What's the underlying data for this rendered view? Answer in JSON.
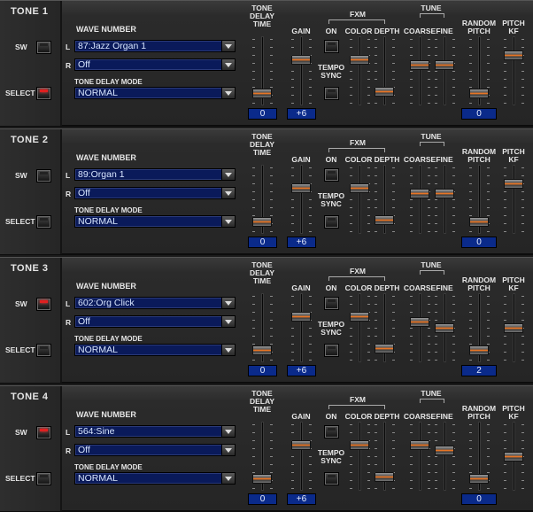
{
  "labels": {
    "sw": "SW",
    "select": "SELECT",
    "wave_number": "WAVE NUMBER",
    "l": "L",
    "r": "R",
    "tone_delay_mode": "TONE DELAY MODE",
    "tone_delay_time": "TONE\nDELAY\nTIME",
    "gain": "GAIN",
    "fxm": "FXM",
    "on": "ON",
    "color": "COLOR",
    "depth": "DEPTH",
    "tempo_sync": "TEMPO\nSYNC",
    "tune": "TUNE",
    "coarse": "COARSE",
    "fine": "FINE",
    "random_pitch": "RANDOM\nPITCH",
    "pitch_kf": "PITCH\nKF"
  },
  "colors": {
    "field_bg": "#0a1a5a",
    "value_box": "#0a2a8a",
    "led_on": "#e02020",
    "knob_accent": "#f08030"
  },
  "tones": [
    {
      "title": "TONE 1",
      "sw_on": false,
      "select_on": true,
      "wave_l": "87:Jazz Organ 1",
      "wave_r": "Off",
      "delay_mode": "NORMAL",
      "delay_time": "0",
      "gain": "+6",
      "random_pitch": "0",
      "fxm_on": false,
      "tempo_sync": false,
      "levels": {
        "delay": 0.12,
        "gain": 0.7,
        "color": 0.7,
        "depth": 0.15,
        "coarse": 0.6,
        "fine": 0.6,
        "random": 0.12,
        "kf": 0.78
      }
    },
    {
      "title": "TONE 2",
      "sw_on": false,
      "select_on": false,
      "wave_l": "89:Organ 1",
      "wave_r": "Off",
      "delay_mode": "NORMAL",
      "delay_time": "0",
      "gain": "+6",
      "random_pitch": "0",
      "fxm_on": false,
      "tempo_sync": false,
      "levels": {
        "delay": 0.12,
        "gain": 0.7,
        "color": 0.7,
        "depth": 0.15,
        "coarse": 0.6,
        "fine": 0.6,
        "random": 0.12,
        "kf": 0.78
      }
    },
    {
      "title": "TONE 3",
      "sw_on": true,
      "select_on": false,
      "wave_l": "602:Org Click",
      "wave_r": "Off",
      "delay_mode": "NORMAL",
      "delay_time": "0",
      "gain": "+6",
      "random_pitch": "2",
      "fxm_on": false,
      "tempo_sync": false,
      "levels": {
        "delay": 0.12,
        "gain": 0.7,
        "color": 0.7,
        "depth": 0.15,
        "coarse": 0.6,
        "fine": 0.5,
        "random": 0.12,
        "kf": 0.5
      }
    },
    {
      "title": "TONE 4",
      "sw_on": true,
      "select_on": false,
      "wave_l": "564:Sine",
      "wave_r": "Off",
      "delay_mode": "NORMAL",
      "delay_time": "0",
      "gain": "+6",
      "random_pitch": "0",
      "fxm_on": false,
      "tempo_sync": false,
      "levels": {
        "delay": 0.12,
        "gain": 0.7,
        "color": 0.7,
        "depth": 0.15,
        "coarse": 0.7,
        "fine": 0.6,
        "random": 0.12,
        "kf": 0.5
      }
    }
  ]
}
